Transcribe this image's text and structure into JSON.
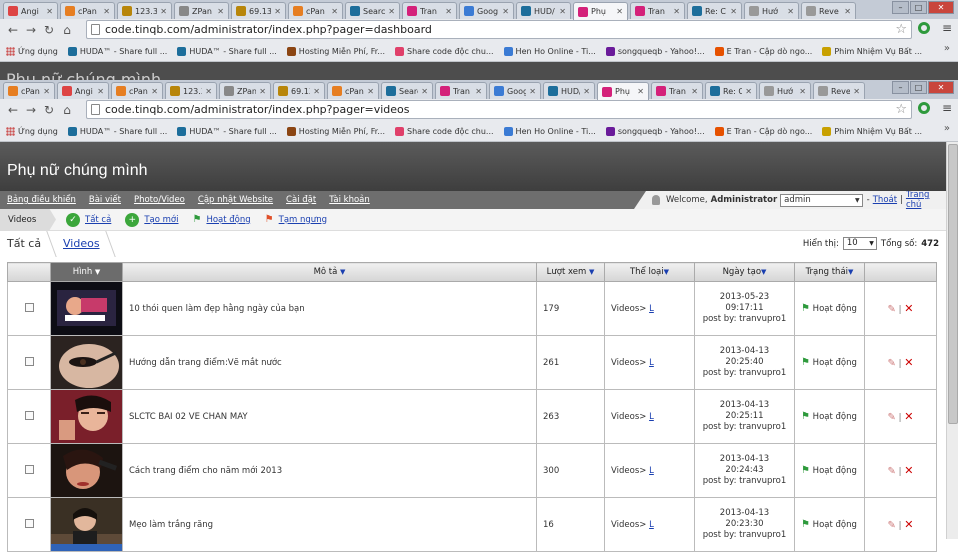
{
  "browser_back": {
    "tabs": [
      {
        "title": "Angi",
        "favcolor": "#d44"
      },
      {
        "title": "cPan",
        "favcolor": "#e67e22"
      },
      {
        "title": "123.3",
        "favcolor": "#b8860b"
      },
      {
        "title": "ZPan",
        "favcolor": "#888"
      },
      {
        "title": "69.13",
        "favcolor": "#b8860b"
      },
      {
        "title": "cPan",
        "favcolor": "#e67e22"
      },
      {
        "title": "Searc",
        "favcolor": "#1d6e9b"
      },
      {
        "title": "Tran",
        "favcolor": "#d4217a"
      },
      {
        "title": "Goog",
        "favcolor": "#3b7bd4"
      },
      {
        "title": "HUD/",
        "favcolor": "#1d6e9b"
      },
      {
        "title": "Phụ",
        "favcolor": "#d4217a",
        "active": true
      },
      {
        "title": "Tran",
        "favcolor": "#d4217a"
      },
      {
        "title": "Re: C",
        "favcolor": "#1d6e9b"
      },
      {
        "title": "Hướ",
        "favcolor": "#999"
      },
      {
        "title": "Reve",
        "favcolor": "#999"
      }
    ],
    "url": "code.tinqb.com/administrator/index.php?pager=dashboard"
  },
  "browser_front": {
    "tabs": [
      {
        "title": "cPan",
        "favcolor": "#e67e22"
      },
      {
        "title": "Angi",
        "favcolor": "#d44"
      },
      {
        "title": "cPan",
        "favcolor": "#e67e22"
      },
      {
        "title": "123.3",
        "favcolor": "#b8860b"
      },
      {
        "title": "ZPan",
        "favcolor": "#888"
      },
      {
        "title": "69.13",
        "favcolor": "#b8860b"
      },
      {
        "title": "cPan",
        "favcolor": "#e67e22"
      },
      {
        "title": "Searc",
        "favcolor": "#1d6e9b"
      },
      {
        "title": "Tran",
        "favcolor": "#d4217a"
      },
      {
        "title": "Goog",
        "favcolor": "#3b7bd4"
      },
      {
        "title": "HUD/",
        "favcolor": "#1d6e9b"
      },
      {
        "title": "Phụ",
        "favcolor": "#d4217a",
        "active": true
      },
      {
        "title": "Tran",
        "favcolor": "#d4217a"
      },
      {
        "title": "Re: C",
        "favcolor": "#1d6e9b"
      },
      {
        "title": "Hướ",
        "favcolor": "#999"
      },
      {
        "title": "Reve",
        "favcolor": "#999"
      }
    ],
    "url": "code.tinqb.com/administrator/index.php?pager=videos"
  },
  "bookmarks": [
    {
      "label": "Ứng dụng",
      "fav": "grid"
    },
    {
      "label": "HUDA™ - Share full ...",
      "favcolor": "#1d6e9b"
    },
    {
      "label": "HUDA™ - Share full ...",
      "favcolor": "#1d6e9b"
    },
    {
      "label": "Hosting Miễn Phí, Fr...",
      "favcolor": "#8b4513"
    },
    {
      "label": "Share code độc chu...",
      "favcolor": "#e0406a"
    },
    {
      "label": "Hen Ho Online - Ti...",
      "favcolor": "#3b7bd4"
    },
    {
      "label": "songqueqb - Yahoo!...",
      "favcolor": "#6a1b9a"
    },
    {
      "label": "E Tran - Cập dò ngo...",
      "favcolor": "#e65100"
    },
    {
      "label": "Phim Nhiệm Vụ Bất ...",
      "favcolor": "#c8a000"
    }
  ],
  "header": {
    "title": "Phụ nữ chúng mình"
  },
  "mainmenu": [
    "Bảng điều khiển",
    "Bài viết",
    "Photo/Video",
    "Cập nhật Website",
    "Cài đặt",
    "Tài khoản"
  ],
  "welcome": {
    "prefix": "Welcome,",
    "user": "Administrator",
    "select_value": "admin",
    "logout": "Thoát",
    "home": "Trang chủ"
  },
  "subbar": {
    "label": "Videos",
    "all": "Tất cả",
    "new": "Tạo mới",
    "active": "Hoạt động",
    "paused": "Tạm ngưng"
  },
  "tabs": {
    "all": "Tất cả",
    "videos": "Videos"
  },
  "pager": {
    "show_label": "Hiển thị:",
    "per_page": "10",
    "total_label": "Tổng số:",
    "total": "472"
  },
  "table": {
    "headers": [
      "Hình",
      "Mô tả",
      "Lượt xem",
      "Thể loại",
      "Ngày tạo",
      "Trạng thái"
    ],
    "rows": [
      {
        "desc": "10 thói quen làm đẹp hằng ngày của bạn",
        "views": "179",
        "cat": "Videos>",
        "cat_link": "L",
        "date": "2013-05-23 09:17:11",
        "post": "post by: tranvupro1",
        "status": "Hoạt động",
        "thumb": "a"
      },
      {
        "desc": "Hướng dẫn trang điểm:Vẽ mắt nước",
        "views": "261",
        "cat": "Videos>",
        "cat_link": "L",
        "date": "2013-04-13 20:25:40",
        "post": "post by: tranvupro1",
        "status": "Hoạt động",
        "thumb": "b"
      },
      {
        "desc": "SLCTC BAI 02 VE CHAN MAY",
        "views": "263",
        "cat": "Videos>",
        "cat_link": "L",
        "date": "2013-04-13 20:25:11",
        "post": "post by: tranvupro1",
        "status": "Hoạt động",
        "thumb": "c"
      },
      {
        "desc": "Cách trang điểm cho năm mới 2013",
        "views": "300",
        "cat": "Videos>",
        "cat_link": "L",
        "date": "2013-04-13 20:24:43",
        "post": "post by: tranvupro1",
        "status": "Hoạt động",
        "thumb": "d"
      },
      {
        "desc": "Mẹo làm trắng răng",
        "views": "16",
        "cat": "Videos>",
        "cat_link": "L",
        "date": "2013-04-13 20:23:30",
        "post": "post by: tranvupro1",
        "status": "Hoạt động",
        "thumb": "e"
      }
    ]
  }
}
